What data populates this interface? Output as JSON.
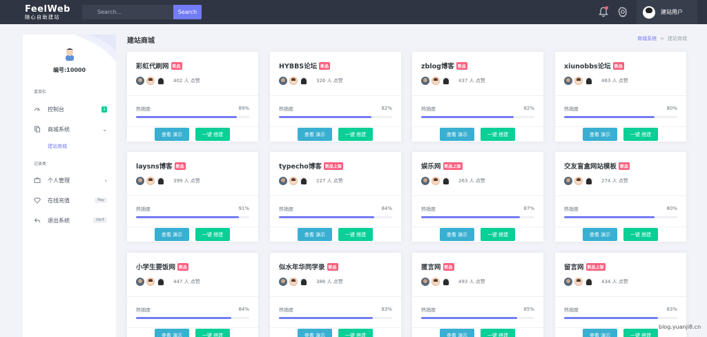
{
  "header": {
    "logo_main": "FeelWeb",
    "logo_sub": "随心自助建站",
    "search_placeholder": "Search...",
    "search_button": "Search",
    "user_name": "建站用户"
  },
  "sidebar": {
    "user_id": "编号:10000",
    "section_menu": "菜单栏",
    "section_records": "记录类",
    "items": [
      {
        "label": "控制台",
        "badge": "1"
      },
      {
        "label": "商城系统"
      },
      {
        "label": "建站商城"
      },
      {
        "label": "个人管理"
      },
      {
        "label": "在线充值",
        "pill": "Pay"
      },
      {
        "label": "退出系统",
        "pill": "OUT"
      }
    ]
  },
  "page": {
    "title": "建站商城",
    "breadcrumb_link": "商城系统",
    "breadcrumb_sep": ">",
    "breadcrumb_current": "建站商城"
  },
  "card_common": {
    "heat_label": "热销度",
    "demo_button": "查看 演示",
    "build_button": "一键 搭建"
  },
  "cards": [
    {
      "name": "彩虹代刷网",
      "tag": "新品",
      "likes": "402 人 点赞",
      "heat": 89,
      "heat_text": "89%"
    },
    {
      "name": "HYBBS论坛",
      "tag": "新品",
      "likes": "326 人 点赞",
      "heat": 82,
      "heat_text": "82%"
    },
    {
      "name": "zblog博客",
      "tag": "新品",
      "likes": "437 人 点赞",
      "heat": 82,
      "heat_text": "82%"
    },
    {
      "name": "xiunobbs论坛",
      "tag": "新品",
      "likes": "463 人 点赞",
      "heat": 80,
      "heat_text": "80%"
    },
    {
      "name": "laysns博客",
      "tag": "新品",
      "likes": "399 人 点赞",
      "heat": 91,
      "heat_text": "91%"
    },
    {
      "name": "typecho博客",
      "tag": "新品上架",
      "likes": "227 人 点赞",
      "heat": 84,
      "heat_text": "84%"
    },
    {
      "name": "娱乐网",
      "tag": "新品上架",
      "likes": "263 人 点赞",
      "heat": 87,
      "heat_text": "87%"
    },
    {
      "name": "交友盲盒网站模板",
      "tag": "新品",
      "likes": "274 人 点赞",
      "heat": 80,
      "heat_text": "80%"
    },
    {
      "name": "小学生要饭网",
      "tag": "新品",
      "likes": "447 人 点赞",
      "heat": 84,
      "heat_text": "84%"
    },
    {
      "name": "似水年华同学录",
      "tag": "新品",
      "likes": "386 人 点赞",
      "heat": 83,
      "heat_text": "83%"
    },
    {
      "name": "匿言网",
      "tag": "新品",
      "likes": "493 人 点赞",
      "heat": 85,
      "heat_text": "85%"
    },
    {
      "name": "留言网",
      "tag": "新品上架",
      "likes": "434 人 点赞",
      "heat": 83,
      "heat_text": "83%"
    }
  ],
  "watermark": "blog.yuanji8.cn",
  "colors": {
    "accent": "#727cf5",
    "tag": "#fa5c7c",
    "demo": "#39afd1",
    "build": "#0acf97",
    "topbar": "#2f3543"
  }
}
